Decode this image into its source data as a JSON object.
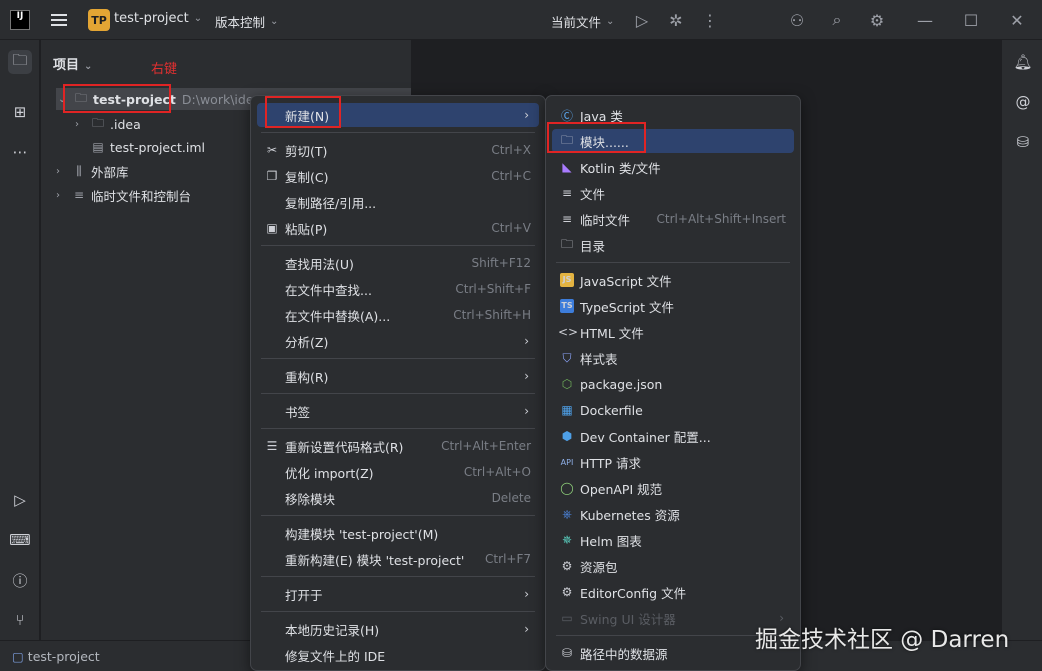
{
  "titlebar": {
    "logo": "IJ",
    "project_badge": "TP",
    "project_name": "test-project",
    "vcs": "版本控制",
    "current_file": "当前文件"
  },
  "project_panel": {
    "title": "项目",
    "annotation": "右键",
    "root": {
      "name": "test-project",
      "path": "D:\\work\\idea"
    },
    "items": [
      {
        "label": ".idea",
        "icon": "folder-icon"
      },
      {
        "label": "test-project.iml",
        "icon": "file-icon"
      },
      {
        "label": "外部库",
        "icon": "library-icon"
      },
      {
        "label": "临时文件和控制台",
        "icon": "scratch-icon"
      }
    ]
  },
  "context_menu": {
    "items": [
      {
        "label": "新建(N)",
        "shortcut": "",
        "submenu": true
      },
      {
        "label": "剪切(T)",
        "shortcut": "Ctrl+X"
      },
      {
        "label": "复制(C)",
        "shortcut": "Ctrl+C"
      },
      {
        "label": "复制路径/引用...",
        "shortcut": ""
      },
      {
        "label": "粘贴(P)",
        "shortcut": "Ctrl+V"
      },
      {
        "label": "查找用法(U)",
        "shortcut": "Shift+F12"
      },
      {
        "label": "在文件中查找...",
        "shortcut": "Ctrl+Shift+F"
      },
      {
        "label": "在文件中替换(A)...",
        "shortcut": "Ctrl+Shift+H"
      },
      {
        "label": "分析(Z)",
        "shortcut": "",
        "submenu": true
      },
      {
        "label": "重构(R)",
        "shortcut": "",
        "submenu": true
      },
      {
        "label": "书签",
        "shortcut": "",
        "submenu": true
      },
      {
        "label": "重新设置代码格式(R)",
        "shortcut": "Ctrl+Alt+Enter"
      },
      {
        "label": "优化 import(Z)",
        "shortcut": "Ctrl+Alt+O"
      },
      {
        "label": "移除模块",
        "shortcut": "Delete"
      },
      {
        "label": "构建模块 'test-project'(M)",
        "shortcut": ""
      },
      {
        "label": "重新构建(E) 模块 'test-project'",
        "shortcut": "Ctrl+F7"
      },
      {
        "label": "打开于",
        "shortcut": "",
        "submenu": true
      },
      {
        "label": "本地历史记录(H)",
        "shortcut": "",
        "submenu": true
      },
      {
        "label": "修复文件上的 IDE",
        "shortcut": ""
      }
    ]
  },
  "new_submenu": {
    "items": [
      {
        "label": "Java 类",
        "shortcut": ""
      },
      {
        "label": "模块......",
        "shortcut": ""
      },
      {
        "label": "Kotlin 类/文件",
        "shortcut": ""
      },
      {
        "label": "文件",
        "shortcut": ""
      },
      {
        "label": "临时文件",
        "shortcut": "Ctrl+Alt+Shift+Insert"
      },
      {
        "label": "目录",
        "shortcut": ""
      },
      {
        "label": "JavaScript 文件",
        "shortcut": ""
      },
      {
        "label": "TypeScript 文件",
        "shortcut": ""
      },
      {
        "label": "HTML 文件",
        "shortcut": ""
      },
      {
        "label": "样式表",
        "shortcut": ""
      },
      {
        "label": "package.json",
        "shortcut": ""
      },
      {
        "label": "Dockerfile",
        "shortcut": ""
      },
      {
        "label": "Dev Container 配置...",
        "shortcut": ""
      },
      {
        "label": "HTTP 请求",
        "shortcut": ""
      },
      {
        "label": "OpenAPI 规范",
        "shortcut": ""
      },
      {
        "label": "Kubernetes 资源",
        "shortcut": ""
      },
      {
        "label": "Helm 图表",
        "shortcut": ""
      },
      {
        "label": "资源包",
        "shortcut": ""
      },
      {
        "label": "EditorConfig 文件",
        "shortcut": ""
      },
      {
        "label": "Swing UI 设计器",
        "shortcut": ""
      },
      {
        "label": "路径中的数据源",
        "shortcut": ""
      }
    ]
  },
  "statusbar": {
    "project": "test-project"
  },
  "watermark": "掘金技术社区 @ Darren",
  "colors": {
    "selection": "#2e436e",
    "annotation_red": "#e02424",
    "badge": "#e3a534"
  }
}
